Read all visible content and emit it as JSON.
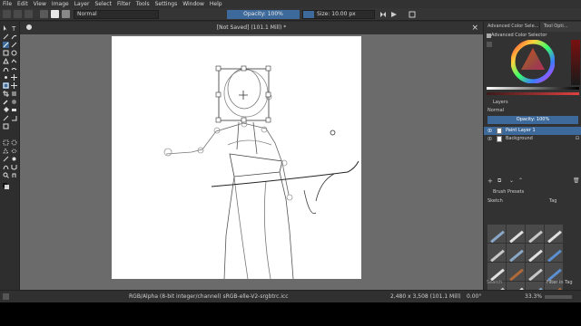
{
  "menubar": {
    "items": [
      "File",
      "Edit",
      "View",
      "Image",
      "Layer",
      "Select",
      "Filter",
      "Tools",
      "Settings",
      "Window",
      "Help"
    ]
  },
  "toolbar": {
    "blend_mode": "Normal",
    "opacity_label": "Opacity: 100%",
    "size_label": "Size: 10.00 px"
  },
  "document": {
    "title": "[Not Saved] (101.1 Mill) *",
    "close": "×"
  },
  "dock": {
    "tabs": [
      "Advanced Color Sele...",
      "Tool Opti..."
    ],
    "color_selector_title": "Advanced Color Selector",
    "layers_title": "Layers",
    "layers_blend": "Normal",
    "layers_opacity": "Opacity: 100%",
    "layers": [
      {
        "name": "Paint Layer 1",
        "selected": true
      },
      {
        "name": "Background",
        "selected": false
      }
    ],
    "brush_presets_title": "Brush Presets",
    "brush_tag_label": "Sketch",
    "brush_tag_dropdown": "Tag",
    "search_placeholder": "Search",
    "filter_in_tag": "Filter in Tag"
  },
  "status": {
    "color_profile": "RGB/Alpha (8-bit integer/channel)  sRGB-elle-V2-srgbtrc.icc",
    "dimensions": "2,480 x 3,508 (101.1 Mill)",
    "rotation": "0.00°",
    "zoom": "33.3%"
  },
  "colors": {
    "accent": "#3d6a9a",
    "canvas_bg": "#6b6b6b",
    "panel": "#323232"
  }
}
